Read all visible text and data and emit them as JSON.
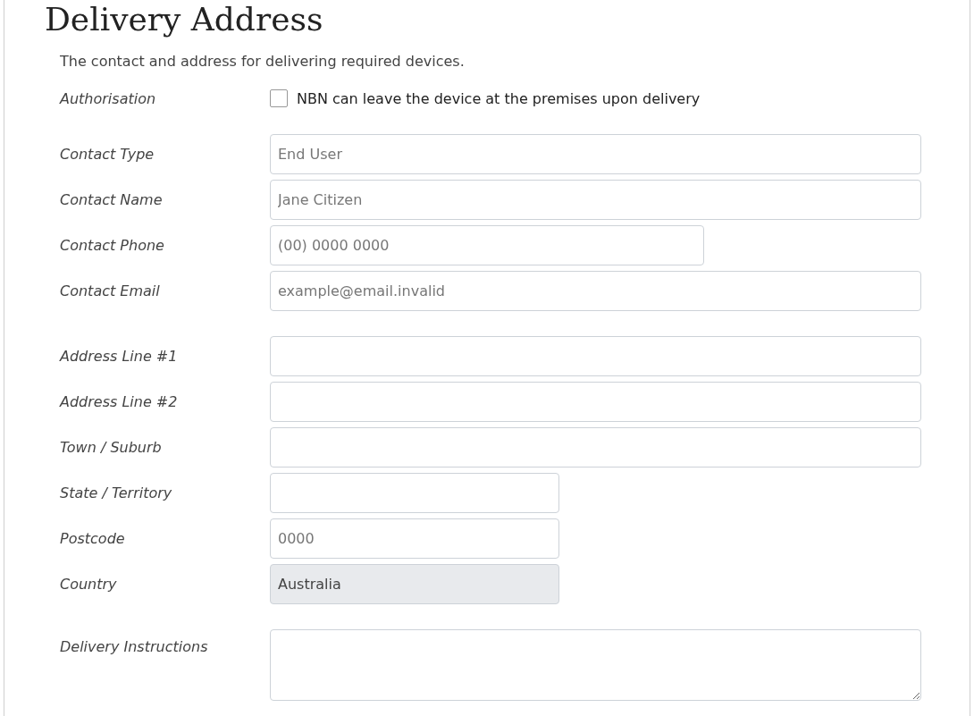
{
  "title": "Delivery Address",
  "description": "The contact and address for delivering required devices.",
  "authorisation": {
    "label": "Authorisation",
    "text": "NBN can leave the device at the premises upon delivery",
    "checked": false
  },
  "groups": [
    [
      {
        "label": "Contact Type",
        "kind": "full",
        "placeholder": "End User",
        "disabled": false
      },
      {
        "label": "Contact Name",
        "kind": "full",
        "placeholder": "Jane Citizen",
        "disabled": false
      },
      {
        "label": "Contact Phone",
        "kind": "medium",
        "placeholder": "(00) 0000 0000",
        "disabled": false
      },
      {
        "label": "Contact Email",
        "kind": "full",
        "placeholder": "example@email.invalid",
        "disabled": false
      }
    ],
    [
      {
        "label": "Address Line #1",
        "kind": "full",
        "disabled": false
      },
      {
        "label": "Address Line #2",
        "kind": "full",
        "disabled": false
      },
      {
        "label": "Town / Suburb",
        "kind": "full",
        "disabled": false
      },
      {
        "label": "State / Territory",
        "kind": "short",
        "disabled": false
      },
      {
        "label": "Postcode",
        "kind": "short",
        "placeholder": "0000",
        "disabled": false
      },
      {
        "label": "Country",
        "kind": "short",
        "value": "Australia",
        "disabled": true
      }
    ],
    [
      {
        "label": "Delivery Instructions",
        "kind": "textarea",
        "disabled": false
      }
    ]
  ]
}
